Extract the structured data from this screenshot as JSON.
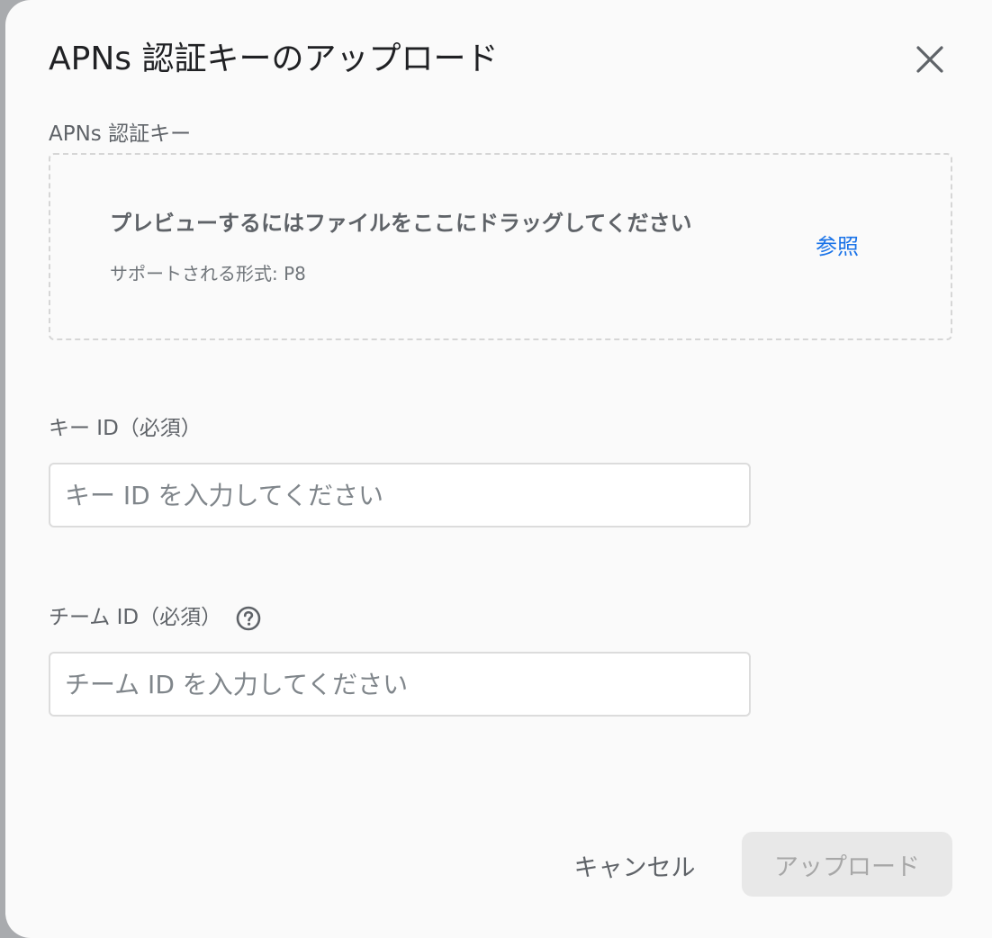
{
  "dialog": {
    "title": "APNs 認証キーのアップロード",
    "close_icon": "close-icon"
  },
  "apns_key": {
    "label": "APNs 認証キー",
    "drop_title": "プレビューするにはファイルをここにドラッグしてください",
    "supported_formats": "サポートされる形式: P8",
    "browse_label": "参照"
  },
  "key_id": {
    "label": "キー ID（必須）",
    "value": "",
    "placeholder": "キー ID を入力してください"
  },
  "team_id": {
    "label": "チーム ID（必須）",
    "value": "",
    "placeholder": "チーム ID を入力してください",
    "help_icon": "help-circle-icon"
  },
  "actions": {
    "cancel_label": "キャンセル",
    "upload_label": "アップロード"
  },
  "colors": {
    "link": "#1a73e8",
    "text_primary": "#202124",
    "text_secondary": "#5f6368",
    "disabled_bg": "#e8e8e8",
    "disabled_text": "#a7a7a7"
  }
}
